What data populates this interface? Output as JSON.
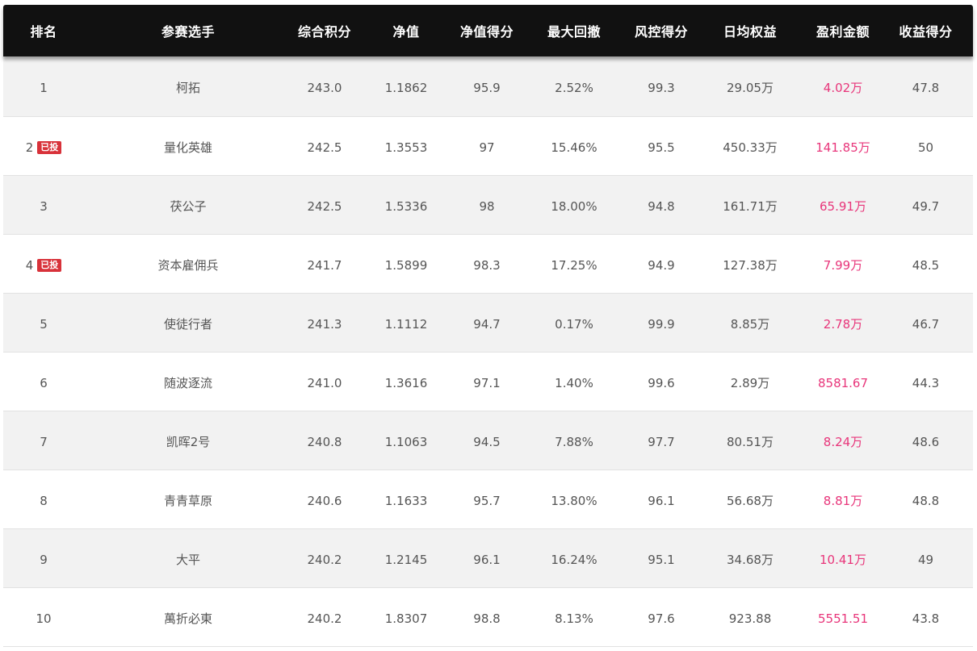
{
  "table": {
    "headers": [
      "排名",
      "参赛选手",
      "综合积分",
      "净值",
      "净值得分",
      "最大回撤",
      "风控得分",
      "日均权益",
      "盈利金额",
      "收益得分"
    ],
    "rows": [
      {
        "rank": "1",
        "badge": "",
        "name": "柯拓",
        "score": "243.0",
        "nav": "1.1862",
        "nav_score": "95.9",
        "max_drawdown": "2.52%",
        "risk_score": "99.3",
        "avg_equity": "29.05万",
        "profit": "4.02万",
        "return_score": "47.8"
      },
      {
        "rank": "2",
        "badge": "已投",
        "name": "量化英雄",
        "score": "242.5",
        "nav": "1.3553",
        "nav_score": "97",
        "max_drawdown": "15.46%",
        "risk_score": "95.5",
        "avg_equity": "450.33万",
        "profit": "141.85万",
        "return_score": "50"
      },
      {
        "rank": "3",
        "badge": "",
        "name": "茯公子",
        "score": "242.5",
        "nav": "1.5336",
        "nav_score": "98",
        "max_drawdown": "18.00%",
        "risk_score": "94.8",
        "avg_equity": "161.71万",
        "profit": "65.91万",
        "return_score": "49.7"
      },
      {
        "rank": "4",
        "badge": "已投",
        "name": "资本雇佣兵",
        "score": "241.7",
        "nav": "1.5899",
        "nav_score": "98.3",
        "max_drawdown": "17.25%",
        "risk_score": "94.9",
        "avg_equity": "127.38万",
        "profit": "7.99万",
        "return_score": "48.5"
      },
      {
        "rank": "5",
        "badge": "",
        "name": "使徒行者",
        "score": "241.3",
        "nav": "1.1112",
        "nav_score": "94.7",
        "max_drawdown": "0.17%",
        "risk_score": "99.9",
        "avg_equity": "8.85万",
        "profit": "2.78万",
        "return_score": "46.7"
      },
      {
        "rank": "6",
        "badge": "",
        "name": "随波逐流",
        "score": "241.0",
        "nav": "1.3616",
        "nav_score": "97.1",
        "max_drawdown": "1.40%",
        "risk_score": "99.6",
        "avg_equity": "2.89万",
        "profit": "8581.67",
        "return_score": "44.3"
      },
      {
        "rank": "7",
        "badge": "",
        "name": "凯晖2号",
        "score": "240.8",
        "nav": "1.1063",
        "nav_score": "94.5",
        "max_drawdown": "7.88%",
        "risk_score": "97.7",
        "avg_equity": "80.51万",
        "profit": "8.24万",
        "return_score": "48.6"
      },
      {
        "rank": "8",
        "badge": "",
        "name": "青青草原",
        "score": "240.6",
        "nav": "1.1633",
        "nav_score": "95.7",
        "max_drawdown": "13.80%",
        "risk_score": "96.1",
        "avg_equity": "56.68万",
        "profit": "8.81万",
        "return_score": "48.8"
      },
      {
        "rank": "9",
        "badge": "",
        "name": "大平",
        "score": "240.2",
        "nav": "1.2145",
        "nav_score": "96.1",
        "max_drawdown": "16.24%",
        "risk_score": "95.1",
        "avg_equity": "34.68万",
        "profit": "10.41万",
        "return_score": "49"
      },
      {
        "rank": "10",
        "badge": "",
        "name": "萬折必東",
        "score": "240.2",
        "nav": "1.8307",
        "nav_score": "98.8",
        "max_drawdown": "8.13%",
        "risk_score": "97.6",
        "avg_equity": "923.88",
        "profit": "5551.51",
        "return_score": "43.8"
      }
    ]
  },
  "colors": {
    "header_bg": "#111111",
    "profit": "#e8357a",
    "badge_bg": "#d8323a",
    "row_alt": "#f2f2f2"
  }
}
